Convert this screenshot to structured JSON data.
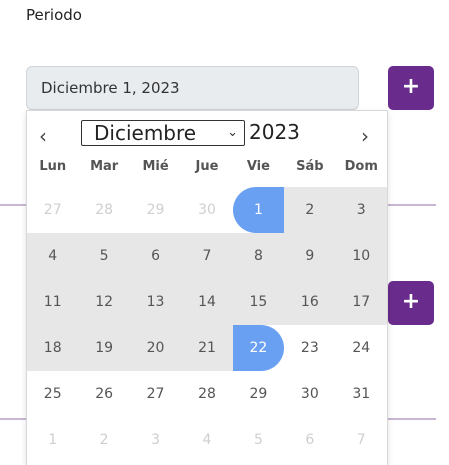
{
  "form": {
    "periodo_label": "Periodo",
    "date_value": "Diciembre 1, 2023",
    "add_button_label": "+"
  },
  "calendar": {
    "prev_label": "‹",
    "next_label": "›",
    "month": "Diciembre",
    "year": "2023",
    "weekdays": [
      "Lun",
      "Mar",
      "Mié",
      "Jue",
      "Vie",
      "Sáb",
      "Dom"
    ],
    "weeks": [
      [
        "27",
        "28",
        "29",
        "30",
        "1",
        "2",
        "3"
      ],
      [
        "4",
        "5",
        "6",
        "7",
        "8",
        "9",
        "10"
      ],
      [
        "11",
        "12",
        "13",
        "14",
        "15",
        "16",
        "17"
      ],
      [
        "18",
        "19",
        "20",
        "21",
        "22",
        "23",
        "24"
      ],
      [
        "25",
        "26",
        "27",
        "28",
        "29",
        "30",
        "31"
      ],
      [
        "1",
        "2",
        "3",
        "4",
        "5",
        "6",
        "7"
      ]
    ],
    "range_start": "1",
    "range_end": "22",
    "accent_color": "#6aa0f2",
    "button_color": "#6a2c8c"
  }
}
